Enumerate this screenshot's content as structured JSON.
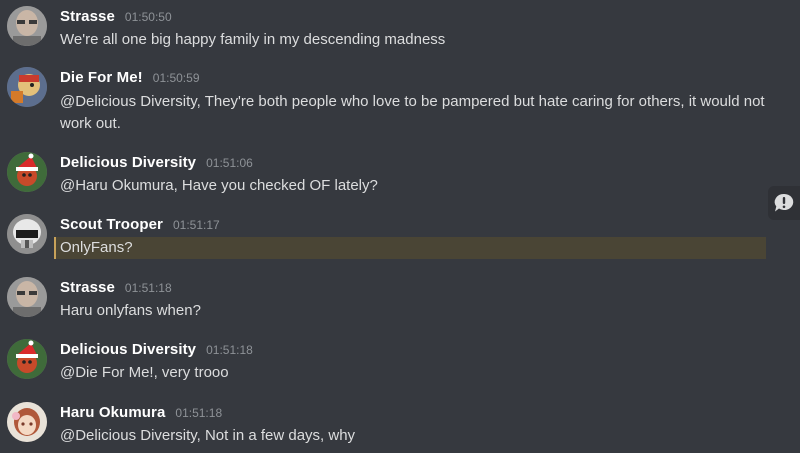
{
  "messages": [
    {
      "author": "Strasse",
      "time": "01:50:50",
      "text": "We're all one big happy family in my descending madness",
      "avatar_icon": "man-glasses-avatar"
    },
    {
      "author": "Die For Me!",
      "time": "01:50:59",
      "text": "@Delicious Diversity, They're both people who love to be pampered but hate caring for others, it would not work out.",
      "avatar_icon": "cartoon-character-avatar"
    },
    {
      "author": "Delicious Diversity",
      "time": "01:51:06",
      "text": "@Haru Okumura, Have you checked OF lately?",
      "avatar_icon": "santa-hat-character-avatar"
    },
    {
      "author": "Scout Trooper",
      "time": "01:51:17",
      "text": "OnlyFans?",
      "avatar_icon": "scout-trooper-helmet-avatar"
    },
    {
      "author": "Strasse",
      "time": "01:51:18",
      "text": "Haru onlyfans when?",
      "avatar_icon": "man-glasses-avatar"
    },
    {
      "author": "Delicious Diversity",
      "time": "01:51:18",
      "text": "@Die For Me!, very trooo",
      "avatar_icon": "santa-hat-character-avatar"
    },
    {
      "author": "Haru Okumura",
      "time": "01:51:18",
      "text": "@Delicious Diversity, Not in a few days, why",
      "avatar_icon": "anime-girl-avatar"
    }
  ],
  "highlighted_message_index": 3,
  "colors": {
    "background": "#36393f",
    "author": "#ffffff",
    "timestamp": "#8e9297",
    "message_text": "#dcddde",
    "highlight_bg": "#4a4535",
    "highlight_border": "#c8a25a"
  }
}
